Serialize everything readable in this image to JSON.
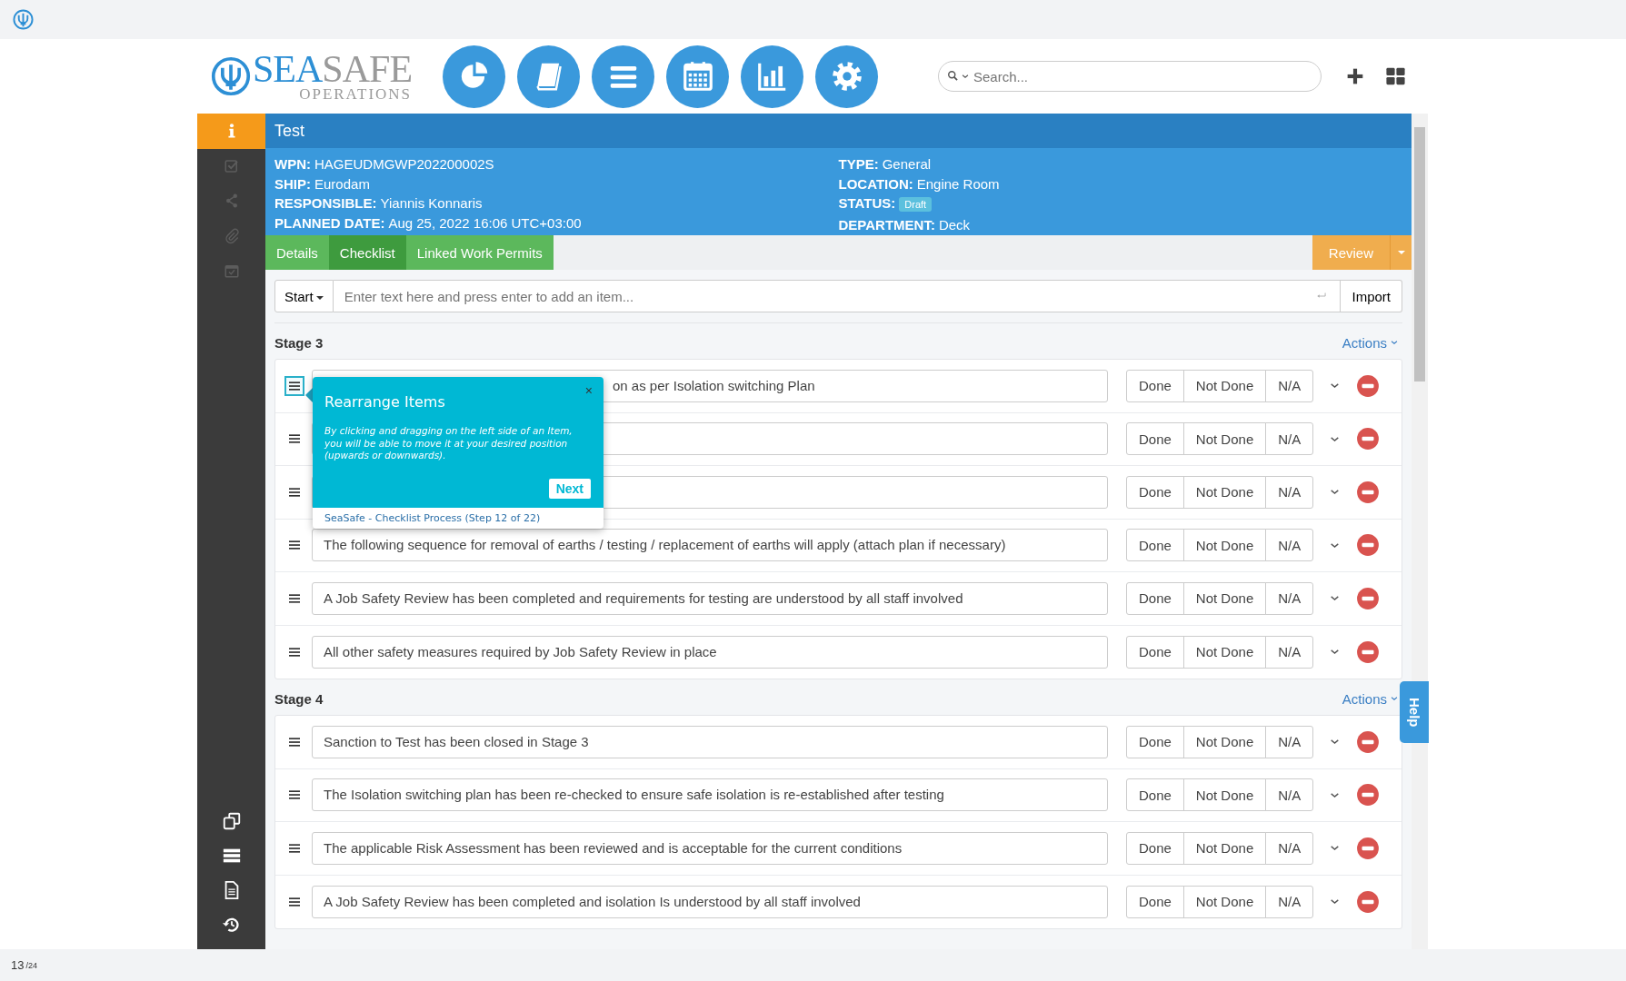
{
  "header": {
    "logo": {
      "primary": "SEA",
      "secondary": "SAFE",
      "tagline": "OPERATIONS"
    },
    "nav": [
      {
        "kind": "pie"
      },
      {
        "kind": "book"
      },
      {
        "kind": "list"
      },
      {
        "kind": "calendar"
      },
      {
        "kind": "chart"
      },
      {
        "kind": "gear"
      }
    ],
    "search": {
      "placeholder": "Search..."
    }
  },
  "sidebar": {
    "items": [
      {
        "kind": "info",
        "selected": true,
        "disabled": false
      },
      {
        "kind": "check",
        "selected": false,
        "disabled": true
      },
      {
        "kind": "share",
        "selected": false,
        "disabled": true
      },
      {
        "kind": "clip",
        "selected": false,
        "disabled": true
      },
      {
        "kind": "calcheck",
        "selected": false,
        "disabled": true
      }
    ],
    "bottom_items": [
      {
        "kind": "copy",
        "disabled": false
      },
      {
        "kind": "stack",
        "disabled": false
      },
      {
        "kind": "doc",
        "disabled": false
      },
      {
        "kind": "history",
        "disabled": false
      }
    ]
  },
  "record": {
    "title": "Test",
    "left_fields": [
      {
        "label": "WPN:",
        "value": "HAGEUDMGWP202200002S"
      },
      {
        "label": "SHIP:",
        "value": "Eurodam"
      },
      {
        "label": "RESPONSIBLE:",
        "value": "Yiannis Konnaris"
      },
      {
        "label": "PLANNED DATE:",
        "value": "Aug 25, 2022 16:06 UTC+03:00"
      }
    ],
    "right_fields": [
      {
        "label": "TYPE:",
        "value": "General"
      },
      {
        "label": "LOCATION:",
        "value": "Engine Room"
      },
      {
        "label": "STATUS:",
        "badge": "Draft"
      },
      {
        "label": "DEPARTMENT:",
        "value": "Deck"
      }
    ]
  },
  "tabs": [
    {
      "label": "Details",
      "selected": false
    },
    {
      "label": "Checklist",
      "selected": true
    },
    {
      "label": "Linked Work Permits",
      "selected": false
    }
  ],
  "review_button": "Review",
  "add_item": {
    "start": "Start",
    "placeholder": "Enter text here and press enter to add an item...",
    "import": "Import"
  },
  "stages": [
    {
      "title": "Stage 3",
      "actions": "Actions",
      "items": [
        {
          "kind": "partly_hidden",
          "text": "on as per Isolation switching Plan",
          "highlighted": true,
          "options": [
            "Done",
            "Not Done",
            "N/A"
          ]
        },
        {
          "kind": "hidden",
          "highlighted": false,
          "options": [
            "Done",
            "Not Done",
            "N/A"
          ]
        },
        {
          "kind": "hidden",
          "highlighted": false,
          "options": [
            "Done",
            "Not Done",
            "N/A"
          ]
        },
        {
          "kind": "normal",
          "text": "The following sequence for removal of earths / testing / replacement of earths will apply (attach plan if necessary)",
          "highlighted": false,
          "options": [
            "Done",
            "Not Done",
            "N/A"
          ]
        },
        {
          "kind": "normal",
          "text": "A Job Safety Review has been completed and requirements for testing are  understood by all staff involved",
          "highlighted": false,
          "options": [
            "Done",
            "Not Done",
            "N/A"
          ]
        },
        {
          "kind": "normal",
          "text": "All other safety measures required by Job Safety Review in place",
          "highlighted": false,
          "options": [
            "Done",
            "Not Done",
            "N/A"
          ]
        }
      ]
    },
    {
      "title": "Stage 4",
      "actions": "Actions",
      "items": [
        {
          "kind": "normal",
          "text": "Sanction to Test has been closed in Stage 3",
          "highlighted": false,
          "options": [
            "Done",
            "Not Done",
            "N/A"
          ]
        },
        {
          "kind": "normal",
          "text": "The Isolation switching plan has been re-checked to ensure safe isolation is re-established after testing",
          "highlighted": false,
          "options": [
            "Done",
            "Not Done",
            "N/A"
          ]
        },
        {
          "kind": "normal",
          "text": "The applicable Risk Assessment has been reviewed and is acceptable for the current conditions",
          "highlighted": false,
          "options": [
            "Done",
            "Not Done",
            "N/A"
          ]
        },
        {
          "kind": "normal",
          "text": "A Job Safety Review has been completed and isolation Is understood by all staff involved",
          "highlighted": false,
          "options": [
            "Done",
            "Not Done",
            "N/A"
          ]
        }
      ]
    }
  ],
  "tour": {
    "title": "Rearrange Items",
    "body": "By clicking and dragging on the left side of an Item, you will be able to move it at your desired position (upwards or downwards).",
    "close": "×",
    "next": "Next",
    "footer": "SeaSafe - Checklist Process (Step 12 of 22)"
  },
  "help_tab": "Help",
  "page_indicator": {
    "current": "13",
    "total": "/24"
  }
}
